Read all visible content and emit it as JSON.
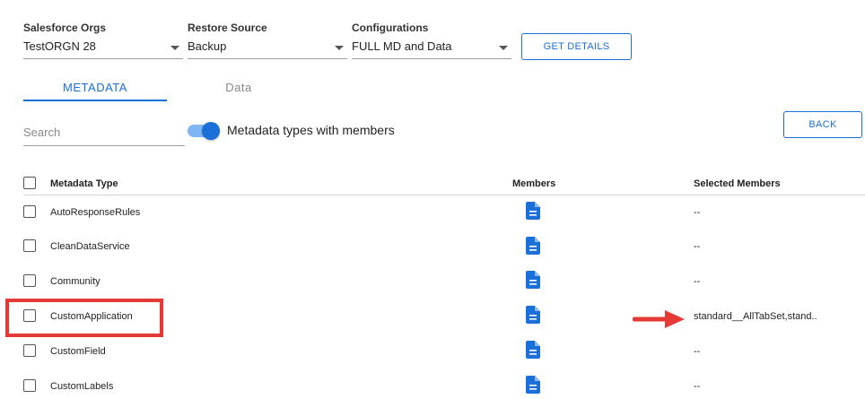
{
  "filters": {
    "orgs": {
      "label": "Salesforce Orgs",
      "value": "TestORGN 28"
    },
    "restore": {
      "label": "Restore Source",
      "value": "Backup"
    },
    "config": {
      "label": "Configurations",
      "value": "FULL MD and Data"
    },
    "get_details": "GET DETAILS"
  },
  "tabs": [
    {
      "label": "METADATA",
      "active": true
    },
    {
      "label": "Data",
      "active": false
    }
  ],
  "search": {
    "placeholder": "Search",
    "value": ""
  },
  "toggle": {
    "label": "Metadata types with members",
    "on": true
  },
  "back_button": "BACK",
  "table": {
    "headers": {
      "type": "Metadata Type",
      "members": "Members",
      "selected": "Selected Members"
    },
    "rows": [
      {
        "name": "AutoResponseRules",
        "selected": "--",
        "checked": false
      },
      {
        "name": "CleanDataService",
        "selected": "--",
        "checked": false
      },
      {
        "name": "Community",
        "selected": "--",
        "checked": false
      },
      {
        "name": "CustomApplication",
        "selected": "standard__AllTabSet,stand..",
        "checked": false,
        "highlighted": true
      },
      {
        "name": "CustomField",
        "selected": "--",
        "checked": false
      },
      {
        "name": "CustomLabels",
        "selected": "--",
        "checked": false
      }
    ]
  },
  "icons": {
    "members": "document-icon",
    "annotation": "red-arrow-icon"
  },
  "colors": {
    "accent": "#1a6fd8",
    "annotation": "#e53935"
  }
}
